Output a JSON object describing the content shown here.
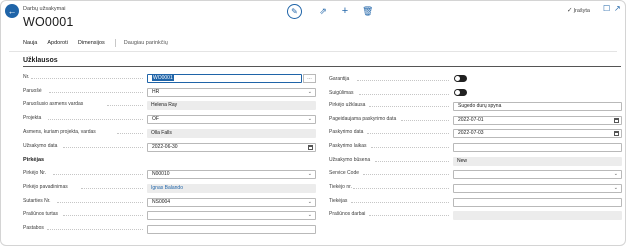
{
  "header": {
    "breadcrumb": "Darbų užsakymai",
    "title": "WO0001",
    "saved_label": "Įrašyta"
  },
  "actions": {
    "items": [
      "Nauja",
      "Apdoroti",
      "Dimensijos"
    ],
    "more_label": "Daugiau parinkčių"
  },
  "section": {
    "title": "Užklausos"
  },
  "left": {
    "no_label": "Nr.",
    "no_value": "WO0001",
    "requester_label": "Paruošė",
    "requester_value": "HR",
    "requester_name_label": "Paruošusio asmens vardas",
    "requester_name_value": "Helena Ray",
    "project_label": "Projekta",
    "project_value": "OF",
    "project_person_label": "Asmens, kuriam projekta, vardas",
    "project_person_value": "Olla Falls",
    "order_date_label": "Užsakymo data",
    "order_date_value": "2022-06-30",
    "group_purchase": "Pirkėjas",
    "buyer_no_label": "Pirkėjo Nr.",
    "buyer_no_value": "N00010",
    "buyer_name_label": "Pirkėjo pavadinimas",
    "buyer_name_value": "Ignas Balando",
    "contract_no_label": "Sutarties Nr.",
    "contract_no_value": "NS0004",
    "req_type_label": "Prašūnos turtas",
    "notes_label": "Pastabos"
  },
  "right": {
    "warranty_label": "Garantija",
    "agreed_label": "Suigūlimas",
    "purchase_req_label": "Pirkėjo užklausa",
    "purchase_req_value": "Sugedo durų spyna",
    "desired_date_label": "Pageidaujama paskyrimo data",
    "desired_date_value": "2022-07-01",
    "assign_date_label": "Paskyrimo data",
    "assign_date_value": "2022-07-03",
    "assign_time_label": "Paskyrimo laikas",
    "status_label": "Užsakymo būsena",
    "status_value": "New",
    "service_code_label": "Service Code",
    "supplier_no_label": "Tiekėjo nr.",
    "supplier_label": "Tiekėjas",
    "hours_label": "Prašūnos darbai"
  }
}
